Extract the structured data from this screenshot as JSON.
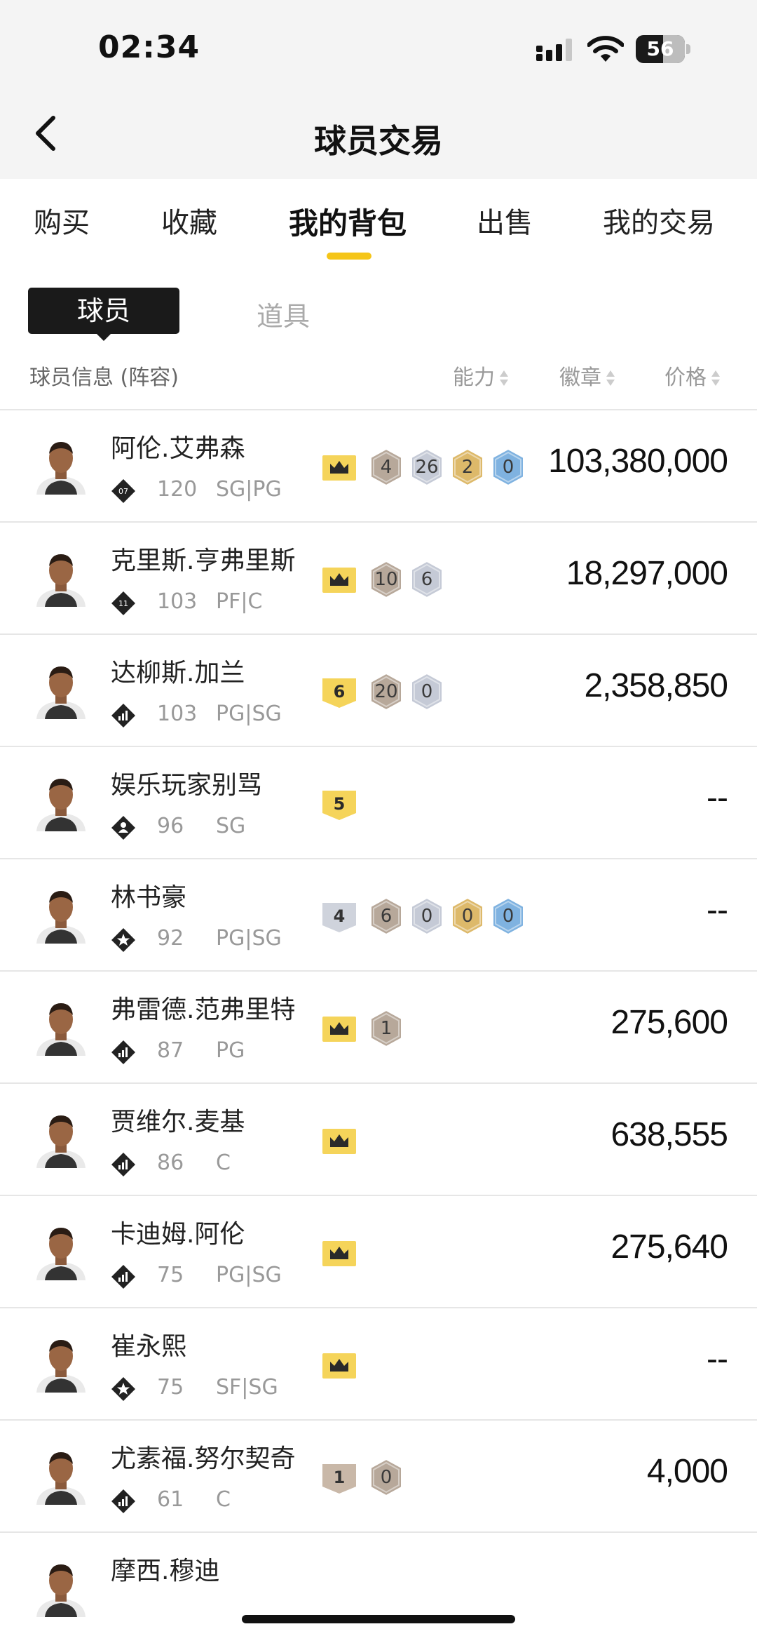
{
  "status_bar": {
    "time": "02:34",
    "battery": "56",
    "battery_level_percent": 56
  },
  "nav": {
    "title": "球员交易"
  },
  "tabs": [
    {
      "label": "购买"
    },
    {
      "label": "收藏"
    },
    {
      "label": "我的背包",
      "active": true
    },
    {
      "label": "出售"
    },
    {
      "label": "我的交易"
    }
  ],
  "subtabs": {
    "active": "球员",
    "inactive": "道具"
  },
  "columns": {
    "info": "球员信息 (阵容)",
    "ability": "能力",
    "badge": "徽章",
    "price": "价格"
  },
  "colors": {
    "accent": "#f5c518",
    "crown": "#f5d45a",
    "bronze": "#b7a89a",
    "silver": "#c5cad6",
    "gold": "#ddb96a",
    "hof": "#7fb2e0"
  },
  "players": [
    {
      "name": "阿伦.艾弗森",
      "tier_icon": "diamond-07-icon",
      "tier_label": "07",
      "rating": "120",
      "position": "SG|PG",
      "flag": {
        "type": "crown",
        "label": ""
      },
      "badges": [
        {
          "tier": "bronze",
          "count": "4"
        },
        {
          "tier": "silver",
          "count": "26"
        },
        {
          "tier": "gold",
          "count": "2"
        },
        {
          "tier": "hof",
          "count": "0"
        }
      ],
      "price": "103,380,000"
    },
    {
      "name": "克里斯.亨弗里斯",
      "tier_icon": "diamond-11-icon",
      "tier_label": "11",
      "rating": "103",
      "position": "PF|C",
      "flag": {
        "type": "crown",
        "label": ""
      },
      "badges": [
        {
          "tier": "bronze",
          "count": "10"
        },
        {
          "tier": "silver",
          "count": "6"
        }
      ],
      "price": "18,297,000"
    },
    {
      "name": "达柳斯.加兰",
      "tier_icon": "bars-icon",
      "tier_label": "",
      "rating": "103",
      "position": "PG|SG",
      "flag": {
        "type": "gold-number",
        "label": "6"
      },
      "badges": [
        {
          "tier": "bronze",
          "count": "20"
        },
        {
          "tier": "silver",
          "count": "0"
        }
      ],
      "price": "2,358,850"
    },
    {
      "name": "娱乐玩家别骂",
      "tier_icon": "person-icon",
      "tier_label": "",
      "rating": "96",
      "position": "SG",
      "flag": {
        "type": "gold-number",
        "label": "5"
      },
      "badges": [],
      "price": "--"
    },
    {
      "name": "林书豪",
      "tier_icon": "star-icon",
      "tier_label": "",
      "rating": "92",
      "position": "PG|SG",
      "flag": {
        "type": "silver-number",
        "label": "4"
      },
      "badges": [
        {
          "tier": "bronze",
          "count": "6"
        },
        {
          "tier": "silver",
          "count": "0"
        },
        {
          "tier": "gold",
          "count": "0"
        },
        {
          "tier": "hof",
          "count": "0"
        }
      ],
      "price": "--"
    },
    {
      "name": "弗雷德.范弗里特",
      "tier_icon": "bars-icon",
      "tier_label": "",
      "rating": "87",
      "position": "PG",
      "flag": {
        "type": "crown",
        "label": ""
      },
      "badges": [
        {
          "tier": "bronze",
          "count": "1"
        }
      ],
      "price": "275,600"
    },
    {
      "name": "贾维尔.麦基",
      "tier_icon": "bars-icon",
      "tier_label": "",
      "rating": "86",
      "position": "C",
      "flag": {
        "type": "crown",
        "label": ""
      },
      "badges": [],
      "price": "638,555"
    },
    {
      "name": "卡迪姆.阿伦",
      "tier_icon": "bars-icon",
      "tier_label": "",
      "rating": "75",
      "position": "PG|SG",
      "flag": {
        "type": "crown",
        "label": ""
      },
      "badges": [],
      "price": "275,640"
    },
    {
      "name": "崔永熙",
      "tier_icon": "star-icon",
      "tier_label": "",
      "rating": "75",
      "position": "SF|SG",
      "flag": {
        "type": "crown",
        "label": ""
      },
      "badges": [],
      "price": "--"
    },
    {
      "name": "尤素福.努尔契奇",
      "tier_icon": "bars-icon",
      "tier_label": "",
      "rating": "61",
      "position": "C",
      "flag": {
        "type": "bronze-number",
        "label": "1"
      },
      "badges": [
        {
          "tier": "bronze",
          "count": "0"
        }
      ],
      "price": "4,000"
    },
    {
      "name": "摩西.穆迪",
      "tier_icon": "bars-icon",
      "tier_label": "",
      "rating": "",
      "position": "",
      "flag": {
        "type": "none",
        "label": ""
      },
      "badges": [],
      "price": ""
    }
  ]
}
